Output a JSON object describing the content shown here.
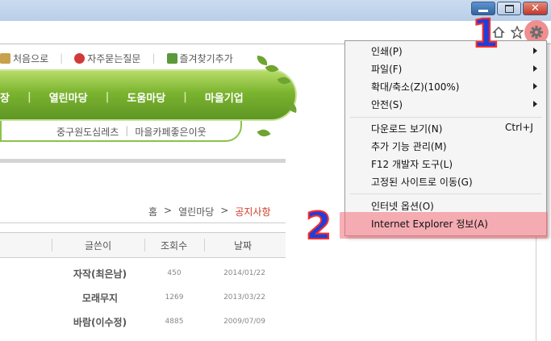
{
  "window": {
    "minimize_label": "minimize",
    "restore_label": "restore",
    "close_label": "close"
  },
  "toolbar": {
    "home_icon": "home-icon",
    "favorites_icon": "star-icon",
    "tools_icon": "gear-icon"
  },
  "site": {
    "toplinks": [
      "처음으로",
      "자주묻는질문",
      "즐겨찾기추가"
    ],
    "nav": [
      "장",
      "열린마당",
      "도움마당",
      "마을기업"
    ],
    "subnav": [
      "중구원도심레츠",
      "마을카페좋은이웃"
    ],
    "breadcrumb": {
      "home": "홈",
      "sep": ">",
      "section": "열린마당",
      "current": "공지사항"
    },
    "table": {
      "headers": [
        "글쓴이",
        "조회수",
        "날짜"
      ],
      "rows": [
        {
          "author": "자작(최은남)",
          "views": "450",
          "date": "2014/01/22"
        },
        {
          "author": "모래무지",
          "views": "1269",
          "date": "2013/03/22"
        },
        {
          "author": "바람(이수정)",
          "views": "4885",
          "date": "2009/07/09"
        }
      ]
    }
  },
  "menu": {
    "items": [
      {
        "label": "인쇄(P)",
        "submenu": true
      },
      {
        "label": "파일(F)",
        "submenu": true
      },
      {
        "label": "확대/축소(Z)(100%)",
        "submenu": true
      },
      {
        "label": "안전(S)",
        "submenu": true
      },
      {
        "label": "다운로드 보기(N)",
        "shortcut": "Ctrl+J"
      },
      {
        "label": "추가 기능 관리(M)"
      },
      {
        "label": "F12 개발자 도구(L)"
      },
      {
        "label": "고정된 사이트로 이동(G)"
      },
      {
        "label": "인터넷 옵션(O)"
      },
      {
        "label": "Internet Explorer 정보(A)"
      }
    ]
  },
  "callouts": {
    "first": "1",
    "second": "2"
  },
  "colors": {
    "highlight": "#f26e78",
    "callout_fill": "#1f3fd8",
    "callout_stroke": "#ff2a2a",
    "nav_green": "#7bb42f"
  }
}
